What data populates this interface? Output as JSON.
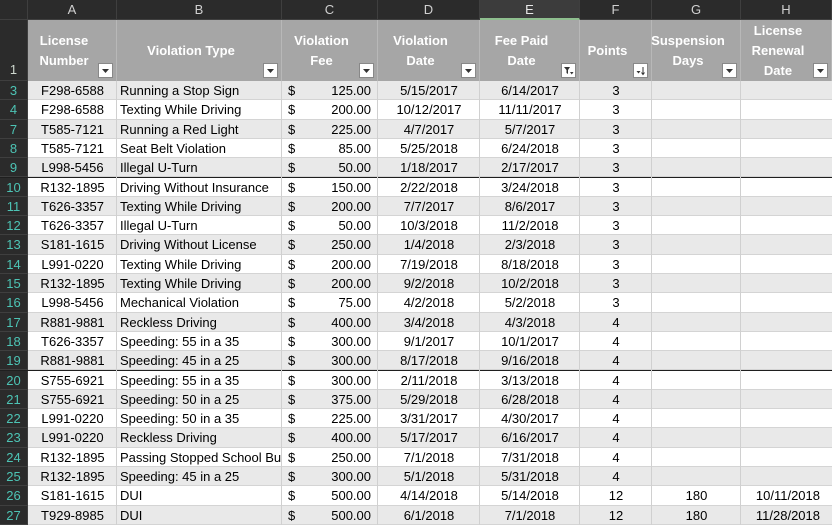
{
  "columns": [
    "A",
    "B",
    "C",
    "D",
    "E",
    "F",
    "G",
    "H"
  ],
  "headers": [
    {
      "label": "License Number",
      "filter": "plain"
    },
    {
      "label": "Violation Type",
      "filter": "plain"
    },
    {
      "label": "Violation Fee",
      "filter": "plain"
    },
    {
      "label": "Violation Date",
      "filter": "plain"
    },
    {
      "label": "Fee Paid Date",
      "filter": "sort-filter"
    },
    {
      "label": "Points",
      "filter": "sorted"
    },
    {
      "label": "Suspension Days",
      "filter": "plain"
    },
    {
      "label": "License Renewal Date",
      "filter": "plain"
    }
  ],
  "header_row_number": "1",
  "rows": [
    {
      "n": "3",
      "lic": "F298-6588",
      "type": "Running a Stop Sign",
      "cur": "$",
      "fee": "125.00",
      "vdate": "5/15/2017",
      "pdate": "6/14/2017",
      "pts": "3",
      "sus": "",
      "ren": ""
    },
    {
      "n": "4",
      "lic": "F298-6588",
      "type": "Texting While Driving",
      "cur": "$",
      "fee": "200.00",
      "vdate": "10/12/2017",
      "pdate": "11/11/2017",
      "pts": "3",
      "sus": "",
      "ren": ""
    },
    {
      "n": "7",
      "lic": "T585-7121",
      "type": "Running a Red Light",
      "cur": "$",
      "fee": "225.00",
      "vdate": "4/7/2017",
      "pdate": "5/7/2017",
      "pts": "3",
      "sus": "",
      "ren": ""
    },
    {
      "n": "8",
      "lic": "T585-7121",
      "type": "Seat Belt Violation",
      "cur": "$",
      "fee": "85.00",
      "vdate": "5/25/2018",
      "pdate": "6/24/2018",
      "pts": "3",
      "sus": "",
      "ren": ""
    },
    {
      "n": "9",
      "lic": "L998-5456",
      "type": "Illegal U-Turn",
      "cur": "$",
      "fee": "50.00",
      "vdate": "1/18/2017",
      "pdate": "2/17/2017",
      "pts": "3",
      "sus": "",
      "ren": ""
    },
    {
      "n": "10",
      "lic": "R132-1895",
      "type": "Driving Without Insurance",
      "cur": "$",
      "fee": "150.00",
      "vdate": "2/22/2018",
      "pdate": "3/24/2018",
      "pts": "3",
      "sus": "",
      "ren": ""
    },
    {
      "n": "11",
      "lic": "T626-3357",
      "type": "Texting While Driving",
      "cur": "$",
      "fee": "200.00",
      "vdate": "7/7/2017",
      "pdate": "8/6/2017",
      "pts": "3",
      "sus": "",
      "ren": ""
    },
    {
      "n": "12",
      "lic": "T626-3357",
      "type": "Illegal U-Turn",
      "cur": "$",
      "fee": "50.00",
      "vdate": "10/3/2018",
      "pdate": "11/2/2018",
      "pts": "3",
      "sus": "",
      "ren": ""
    },
    {
      "n": "13",
      "lic": "S181-1615",
      "type": "Driving Without License",
      "cur": "$",
      "fee": "250.00",
      "vdate": "1/4/2018",
      "pdate": "2/3/2018",
      "pts": "3",
      "sus": "",
      "ren": ""
    },
    {
      "n": "14",
      "lic": "L991-0220",
      "type": "Texting While Driving",
      "cur": "$",
      "fee": "200.00",
      "vdate": "7/19/2018",
      "pdate": "8/18/2018",
      "pts": "3",
      "sus": "",
      "ren": ""
    },
    {
      "n": "15",
      "lic": "R132-1895",
      "type": "Texting While Driving",
      "cur": "$",
      "fee": "200.00",
      "vdate": "9/2/2018",
      "pdate": "10/2/2018",
      "pts": "3",
      "sus": "",
      "ren": ""
    },
    {
      "n": "16",
      "lic": "L998-5456",
      "type": "Mechanical Violation",
      "cur": "$",
      "fee": "75.00",
      "vdate": "4/2/2018",
      "pdate": "5/2/2018",
      "pts": "3",
      "sus": "",
      "ren": ""
    },
    {
      "n": "17",
      "lic": "R881-9881",
      "type": "Reckless Driving",
      "cur": "$",
      "fee": "400.00",
      "vdate": "3/4/2018",
      "pdate": "4/3/2018",
      "pts": "4",
      "sus": "",
      "ren": ""
    },
    {
      "n": "18",
      "lic": "T626-3357",
      "type": "Speeding: 55 in a 35",
      "cur": "$",
      "fee": "300.00",
      "vdate": "9/1/2017",
      "pdate": "10/1/2017",
      "pts": "4",
      "sus": "",
      "ren": ""
    },
    {
      "n": "19",
      "lic": "R881-9881",
      "type": "Speeding: 45 in a 25",
      "cur": "$",
      "fee": "300.00",
      "vdate": "8/17/2018",
      "pdate": "9/16/2018",
      "pts": "4",
      "sus": "",
      "ren": ""
    },
    {
      "n": "20",
      "lic": "S755-6921",
      "type": "Speeding: 55 in a 35",
      "cur": "$",
      "fee": "300.00",
      "vdate": "2/11/2018",
      "pdate": "3/13/2018",
      "pts": "4",
      "sus": "",
      "ren": ""
    },
    {
      "n": "21",
      "lic": "S755-6921",
      "type": "Speeding: 50 in a 25",
      "cur": "$",
      "fee": "375.00",
      "vdate": "5/29/2018",
      "pdate": "6/28/2018",
      "pts": "4",
      "sus": "",
      "ren": ""
    },
    {
      "n": "22",
      "lic": "L991-0220",
      "type": "Speeding: 50 in a 35",
      "cur": "$",
      "fee": "225.00",
      "vdate": "3/31/2017",
      "pdate": "4/30/2017",
      "pts": "4",
      "sus": "",
      "ren": ""
    },
    {
      "n": "23",
      "lic": "L991-0220",
      "type": "Reckless Driving",
      "cur": "$",
      "fee": "400.00",
      "vdate": "5/17/2017",
      "pdate": "6/16/2017",
      "pts": "4",
      "sus": "",
      "ren": ""
    },
    {
      "n": "24",
      "lic": "R132-1895",
      "type": "Passing Stopped School Bu",
      "cur": "$",
      "fee": "250.00",
      "vdate": "7/1/2018",
      "pdate": "7/31/2018",
      "pts": "4",
      "sus": "",
      "ren": ""
    },
    {
      "n": "25",
      "lic": "R132-1895",
      "type": "Speeding: 45 in a 25",
      "cur": "$",
      "fee": "300.00",
      "vdate": "5/1/2018",
      "pdate": "5/31/2018",
      "pts": "4",
      "sus": "",
      "ren": ""
    },
    {
      "n": "26",
      "lic": "S181-1615",
      "type": "DUI",
      "cur": "$",
      "fee": "500.00",
      "vdate": "4/14/2018",
      "pdate": "5/14/2018",
      "pts": "12",
      "sus": "180",
      "ren": "10/11/2018"
    },
    {
      "n": "27",
      "lic": "T929-8985",
      "type": "DUI",
      "cur": "$",
      "fee": "500.00",
      "vdate": "6/1/2018",
      "pdate": "7/1/2018",
      "pts": "12",
      "sus": "180",
      "ren": "11/28/2018"
    }
  ]
}
